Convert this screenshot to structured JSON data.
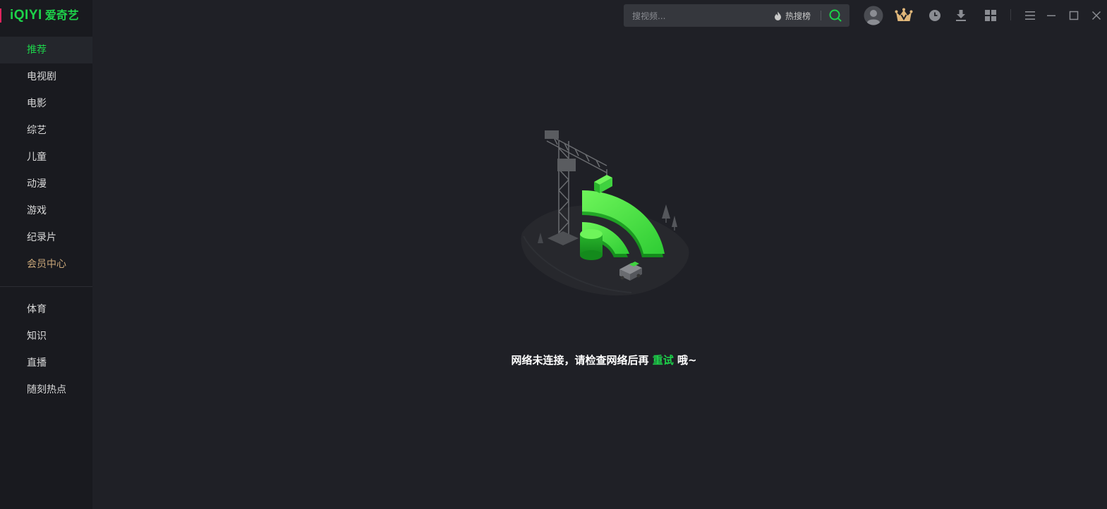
{
  "app": {
    "logo_text": "iQIYI",
    "logo_cn": "爱奇艺",
    "brand_color": "#1dd24a",
    "vip_color": "#c9a779"
  },
  "sidebar": {
    "items": [
      {
        "label": "推荐",
        "active": true
      },
      {
        "label": "电视剧"
      },
      {
        "label": "电影"
      },
      {
        "label": "综艺"
      },
      {
        "label": "儿童"
      },
      {
        "label": "动漫"
      },
      {
        "label": "游戏"
      },
      {
        "label": "纪录片"
      },
      {
        "label": "会员中心",
        "vip": true
      }
    ],
    "items2": [
      {
        "label": "体育"
      },
      {
        "label": "知识"
      },
      {
        "label": "直播"
      },
      {
        "label": "随刻热点"
      }
    ]
  },
  "search": {
    "placeholder": "搜视频...",
    "hot_label": "热搜榜",
    "icon": "search-icon"
  },
  "toolbar": {
    "icons": [
      "avatar-icon",
      "vip-crown-icon",
      "history-icon",
      "download-icon",
      "apps-grid-icon",
      "menu-icon",
      "minimize-icon",
      "maximize-icon",
      "close-icon"
    ]
  },
  "error": {
    "message_prefix": "网络未连接，请检查网络后再",
    "retry_label": "重试",
    "message_suffix": "哦~"
  }
}
